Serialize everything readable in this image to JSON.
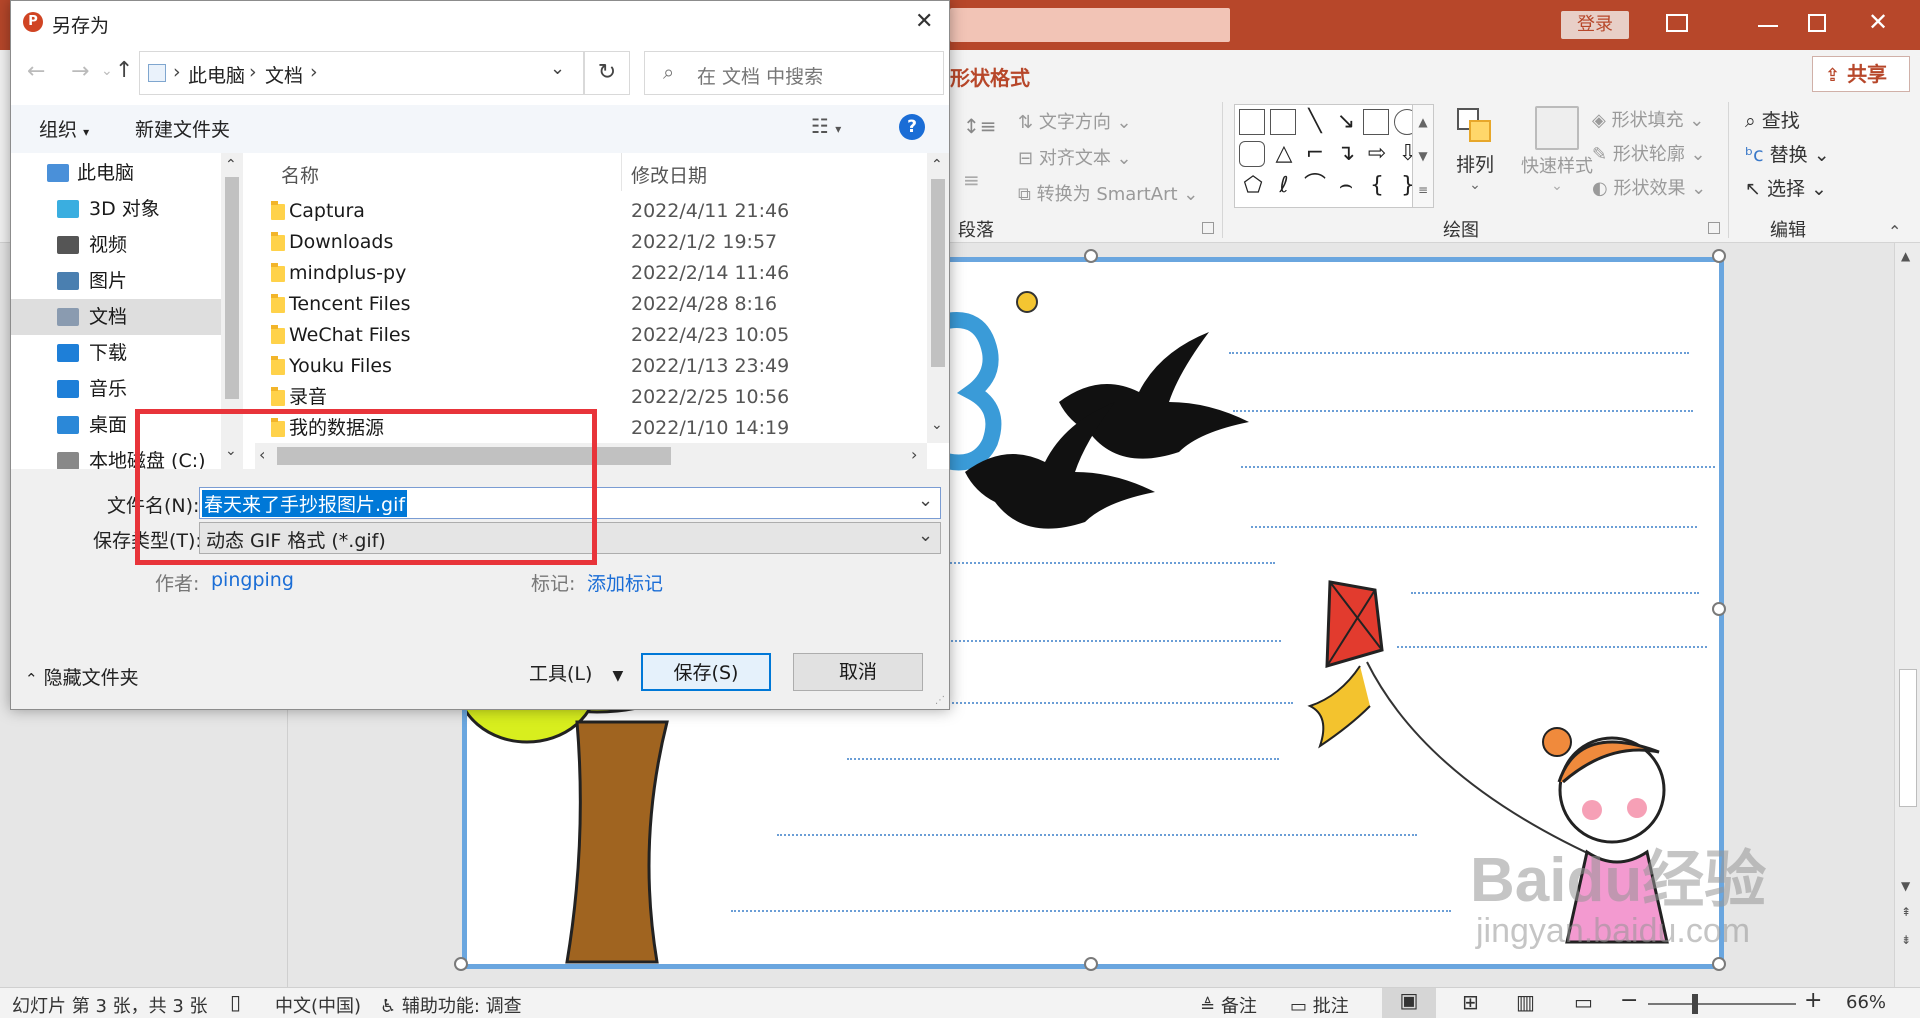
{
  "dialog": {
    "title": "另存为",
    "close_glyph": "✕",
    "breadcrumb": [
      "此电脑",
      "文档"
    ],
    "search_placeholder": "在 文档 中搜索",
    "toolbar": {
      "organize": "组织",
      "new_folder": "新建文件夹",
      "help": "?"
    },
    "nav_items": [
      {
        "label": "此电脑",
        "icon": "computer-icon"
      },
      {
        "label": "3D 对象",
        "icon": "cube-3d-icon"
      },
      {
        "label": "视频",
        "icon": "video-icon"
      },
      {
        "label": "图片",
        "icon": "picture-icon"
      },
      {
        "label": "文档",
        "icon": "document-icon",
        "selected": true
      },
      {
        "label": "下载",
        "icon": "download-icon"
      },
      {
        "label": "音乐",
        "icon": "music-icon"
      },
      {
        "label": "桌面",
        "icon": "desktop-icon"
      },
      {
        "label": "本地磁盘 (C:)",
        "icon": "disk-icon"
      }
    ],
    "columns": {
      "name": "名称",
      "date": "修改日期"
    },
    "files": [
      {
        "name": "Captura",
        "date": "2022/4/11 21:46"
      },
      {
        "name": "Downloads",
        "date": "2022/1/2 19:57"
      },
      {
        "name": "mindplus-py",
        "date": "2022/2/14 11:46"
      },
      {
        "name": "Tencent Files",
        "date": "2022/4/28 8:16"
      },
      {
        "name": "WeChat Files",
        "date": "2022/4/23 10:05"
      },
      {
        "name": "Youku Files",
        "date": "2022/1/13 23:49"
      },
      {
        "name": "录音",
        "date": "2022/2/25 10:56"
      },
      {
        "name": "我的数据源",
        "date": "2022/1/10 14:19"
      }
    ],
    "filename_label": "文件名(N):",
    "filename_value": "春天来了手抄报图片.gif",
    "filetype_label": "保存类型(T):",
    "filetype_value": "动态 GIF 格式 (*.gif)",
    "author_label": "作者:",
    "author_value": "pingping",
    "tags_label": "标记:",
    "tags_value": "添加标记",
    "hide_folders": "隐藏文件夹",
    "tools_label": "工具(L)",
    "save_label": "保存(S)",
    "cancel_label": "取消",
    "highlight_color": "#e8343a"
  },
  "powerpoint": {
    "login": "登录",
    "share": "共享",
    "contextual_tab": "形状格式",
    "ribbon": {
      "text_direction": "文字方向",
      "align_text": "对齐文本",
      "convert_smartart": "转换为 SmartArt",
      "paragraph": "段落",
      "arrange": "排列",
      "quick_styles": "快速样式",
      "shape_fill": "形状填充",
      "shape_outline": "形状轮廓",
      "shape_effects": "形状效果",
      "drawing": "绘图",
      "find": "查找",
      "replace": "替换",
      "select": "选择",
      "editing": "编辑"
    },
    "status": {
      "slide_info": "幻灯片 第 3 张，共 3 张",
      "language": "中文(中国)",
      "accessibility": "辅助功能: 调查",
      "notes": "备注",
      "comments": "批注",
      "zoom": "66%"
    },
    "accent_color": "#b7472a"
  },
  "watermark": {
    "line1": "Baidu经验",
    "line2": "jingyan.baidu.com"
  }
}
